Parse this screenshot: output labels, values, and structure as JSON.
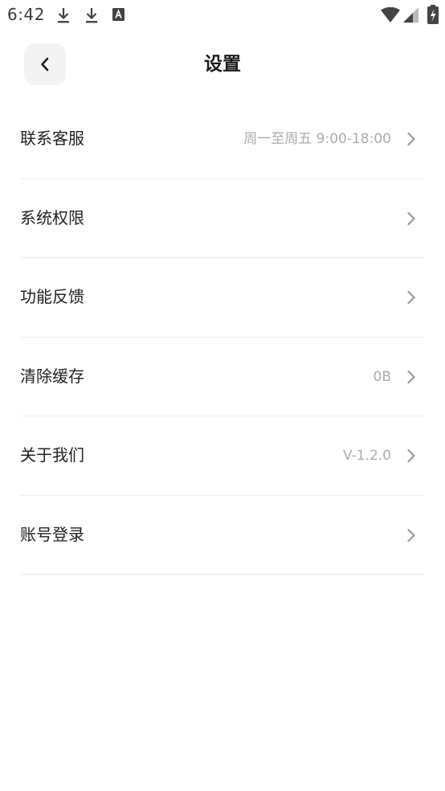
{
  "status_bar": {
    "time": "6:42",
    "icons": [
      "download-icon",
      "download-icon",
      "font-app-icon",
      "wifi-icon",
      "cellular-signal-icon",
      "battery-charging-icon"
    ]
  },
  "header": {
    "title": "设置",
    "back_icon": "chevron-left-icon"
  },
  "settings": {
    "items": [
      {
        "id": "customer-service",
        "label": "联系客服",
        "value": "周一至周五 9:00-18:00"
      },
      {
        "id": "system-permissions",
        "label": "系统权限",
        "value": ""
      },
      {
        "id": "feedback",
        "label": "功能反馈",
        "value": ""
      },
      {
        "id": "clear-cache",
        "label": "清除缓存",
        "value": "0B"
      },
      {
        "id": "about-us",
        "label": "关于我们",
        "value": "V-1.2.0"
      },
      {
        "id": "account-login",
        "label": "账号登录",
        "value": ""
      }
    ]
  },
  "colors": {
    "background": "#ffffff",
    "text_primary": "#222222",
    "text_secondary": "#ababab",
    "divider": "#ededed",
    "back_button_bg": "#f3f3f3",
    "chevron": "#9a9a9a"
  }
}
